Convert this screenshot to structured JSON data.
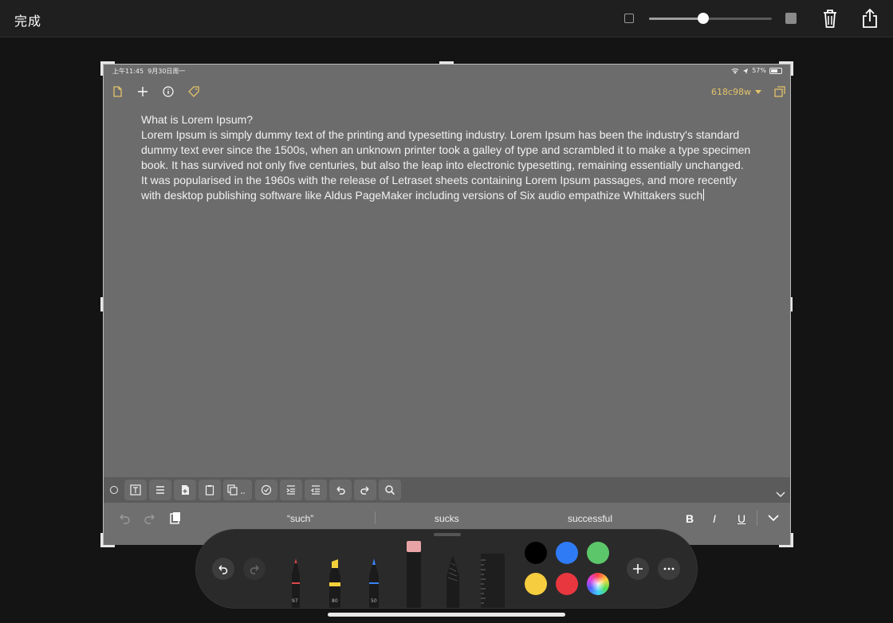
{
  "topbar": {
    "done_label": "完成",
    "opacity_slider_value": 0.44,
    "icons": [
      "trash-icon",
      "share-icon",
      "square-outline-icon",
      "square-filled-icon"
    ]
  },
  "status": {
    "time": "上午11:45",
    "date": "9月30日周一",
    "battery": "57%"
  },
  "note_toolbar": {
    "icons": [
      "document-icon",
      "plus-icon",
      "info-icon",
      "tag-icon",
      "expand-icon"
    ],
    "commit_label": "618c98w"
  },
  "document": {
    "title": "What is Lorem Ipsum?",
    "lines": [
      "Lorem Ipsum is simply dummy text of the printing and typesetting industry. Lorem Ipsum has been the industry's standard",
      "dummy text ever since the 1500s, when an unknown printer took a galley of type and scrambled it to make a type specimen",
      "book. It has survived not only five centuries, but also the leap into electronic typesetting, remaining essentially unchanged.",
      "It was popularised in the 1960s with the release of Letraset sheets containing Lorem Ipsum passages, and more recently",
      "with desktop publishing software like Aldus PageMaker including versions of Six audio empathize Whittakers such"
    ]
  },
  "format_bar": {
    "buttons": [
      "text-frame-icon",
      "list-icon",
      "add-file-icon",
      "clipboard-icon",
      "copy-more-icon",
      "checkbox-icon",
      "indent-icon",
      "outdent-icon",
      "undo-icon",
      "redo-icon",
      "search-icon"
    ]
  },
  "suggestions": {
    "items": [
      "“such”",
      "sucks",
      "successful"
    ],
    "bold": "B",
    "italic": "I",
    "underline": "U"
  },
  "palette": {
    "tools": [
      {
        "name": "pen",
        "color": "#e0474c",
        "value": "97"
      },
      {
        "name": "marker",
        "color": "#f2cf3b",
        "value": "80"
      },
      {
        "name": "pencil",
        "color": "#3a82f7",
        "value": "50"
      },
      {
        "name": "eraser",
        "color": "#e8a3a6",
        "value": ""
      },
      {
        "name": "lasso",
        "color": "#555555",
        "value": ""
      },
      {
        "name": "ruler",
        "color": "#444444",
        "value": ""
      }
    ],
    "swatches": [
      "#000000",
      "#2f7bf6",
      "#5cc76a",
      "#f6cd3e",
      "#e8373f",
      "color-wheel"
    ]
  }
}
